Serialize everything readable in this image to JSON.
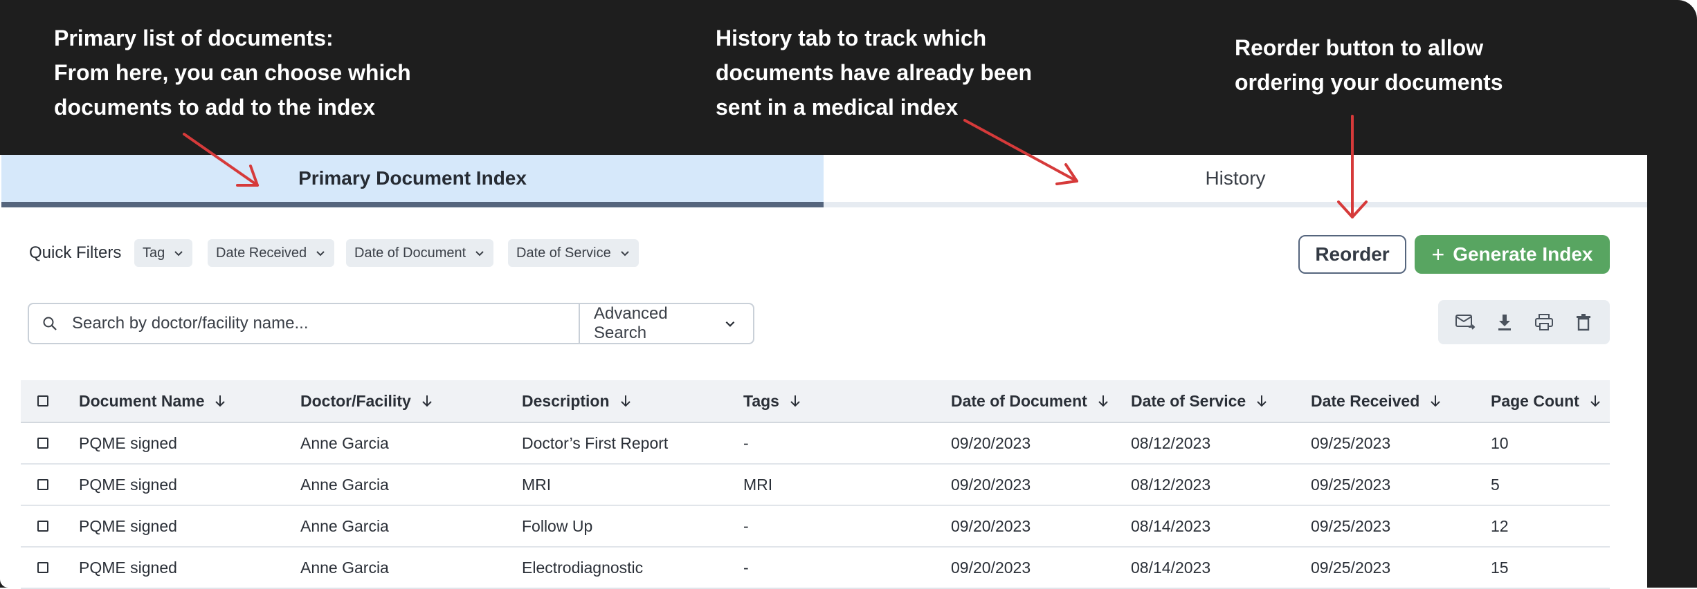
{
  "annotations": {
    "primary": [
      "Primary list of documents:",
      "From here, you can choose which",
      "documents to add to the index"
    ],
    "history": [
      "History tab to track which",
      "documents have already been",
      "sent in a medical index"
    ],
    "reorder": [
      "Reorder button to allow",
      "ordering your documents"
    ]
  },
  "tabs": {
    "primary": "Primary Document Index",
    "history": "History"
  },
  "quick_filters": {
    "label": "Quick Filters",
    "chips": [
      "Tag",
      "Date Received",
      "Date of Document",
      "Date of Service"
    ]
  },
  "buttons": {
    "reorder": "Reorder",
    "generate": "Generate Index"
  },
  "search": {
    "placeholder": "Search by doctor/facility name...",
    "advanced": "Advanced Search"
  },
  "toolbar_icons": [
    "email-forward-icon",
    "download-icon",
    "print-icon",
    "delete-icon"
  ],
  "colors": {
    "accent_green": "#58a561",
    "tab_active_bg": "#d6e8fa",
    "tab_active_underline": "#55657d",
    "arrow_red": "#d63a3a"
  },
  "table": {
    "columns": [
      "Document Name",
      "Doctor/Facility",
      "Description",
      "Tags",
      "Date of Document",
      "Date of Service",
      "Date Received",
      "Page Count"
    ],
    "rows": [
      [
        "PQME signed",
        "Anne Garcia",
        "Doctor’s First Report",
        "-",
        "09/20/2023",
        "08/12/2023",
        "09/25/2023",
        "10"
      ],
      [
        "PQME signed",
        "Anne Garcia",
        "MRI",
        "MRI",
        "09/20/2023",
        "08/12/2023",
        "09/25/2023",
        "5"
      ],
      [
        "PQME signed",
        "Anne Garcia",
        "Follow Up",
        "-",
        "09/20/2023",
        "08/14/2023",
        "09/25/2023",
        "12"
      ],
      [
        "PQME signed",
        "Anne Garcia",
        "Electrodiagnostic",
        "-",
        "09/20/2023",
        "08/14/2023",
        "09/25/2023",
        "15"
      ]
    ]
  }
}
